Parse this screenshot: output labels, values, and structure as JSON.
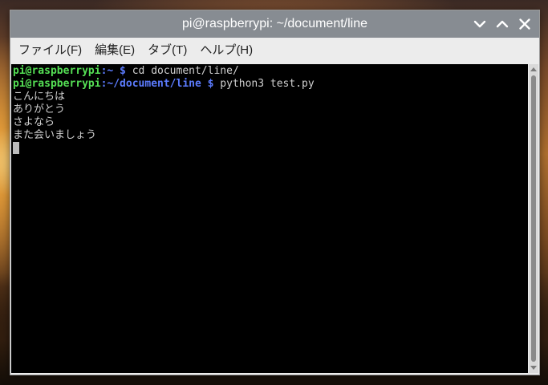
{
  "window": {
    "title": "pi@raspberrypi: ~/document/line"
  },
  "titlebar_buttons": [
    {
      "name": "minimize",
      "icon": "chevron-down-icon"
    },
    {
      "name": "maximize",
      "icon": "chevron-up-icon"
    },
    {
      "name": "close",
      "icon": "close-icon"
    }
  ],
  "menu": {
    "items": [
      "ファイル(F)",
      "編集(E)",
      "タブ(T)",
      "ヘルプ(H)"
    ]
  },
  "terminal": {
    "prompt_user": "pi@raspberrypi",
    "colon": ":",
    "lines": [
      {
        "path": "~",
        "dollar": " $",
        "command": " cd document/line/"
      },
      {
        "path": "~/document/line",
        "dollar": " $",
        "command": " python3 test.py"
      }
    ],
    "output": [
      "こんにちは",
      "ありがとう",
      "さよなら",
      "また会いましょう"
    ]
  },
  "colors": {
    "user": "#55e055",
    "path": "#5c7cff",
    "text": "#d0d0d0",
    "background": "#000000",
    "titlebar": "#878c92"
  }
}
